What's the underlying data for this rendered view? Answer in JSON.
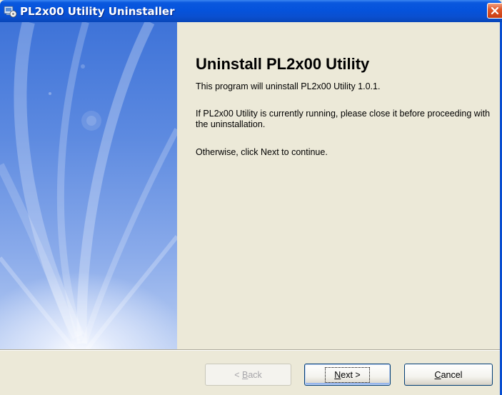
{
  "window": {
    "title": "PL2x00 Utility Uninstaller"
  },
  "content": {
    "heading": "Uninstall PL2x00 Utility",
    "paragraph1": "This program will uninstall PL2x00 Utility 1.0.1.",
    "paragraph2": "If PL2x00 Utility is currently running, please close it before proceeding with the uninstallation.",
    "paragraph3": "Otherwise, click Next to continue."
  },
  "buttons": {
    "back": {
      "prefix": "< ",
      "accel": "B",
      "rest": "ack",
      "enabled": false
    },
    "next": {
      "accel": "N",
      "rest": "ext >",
      "enabled": true
    },
    "cancel": {
      "accel": "C",
      "rest": "ancel",
      "enabled": true
    }
  },
  "colors": {
    "titlebar": "#0553dc",
    "background": "#ece9d8",
    "close_button": "#e0582a",
    "disabled_text": "#a7a6aa"
  },
  "icons": {
    "app": "installer-icon",
    "close": "close-icon"
  }
}
